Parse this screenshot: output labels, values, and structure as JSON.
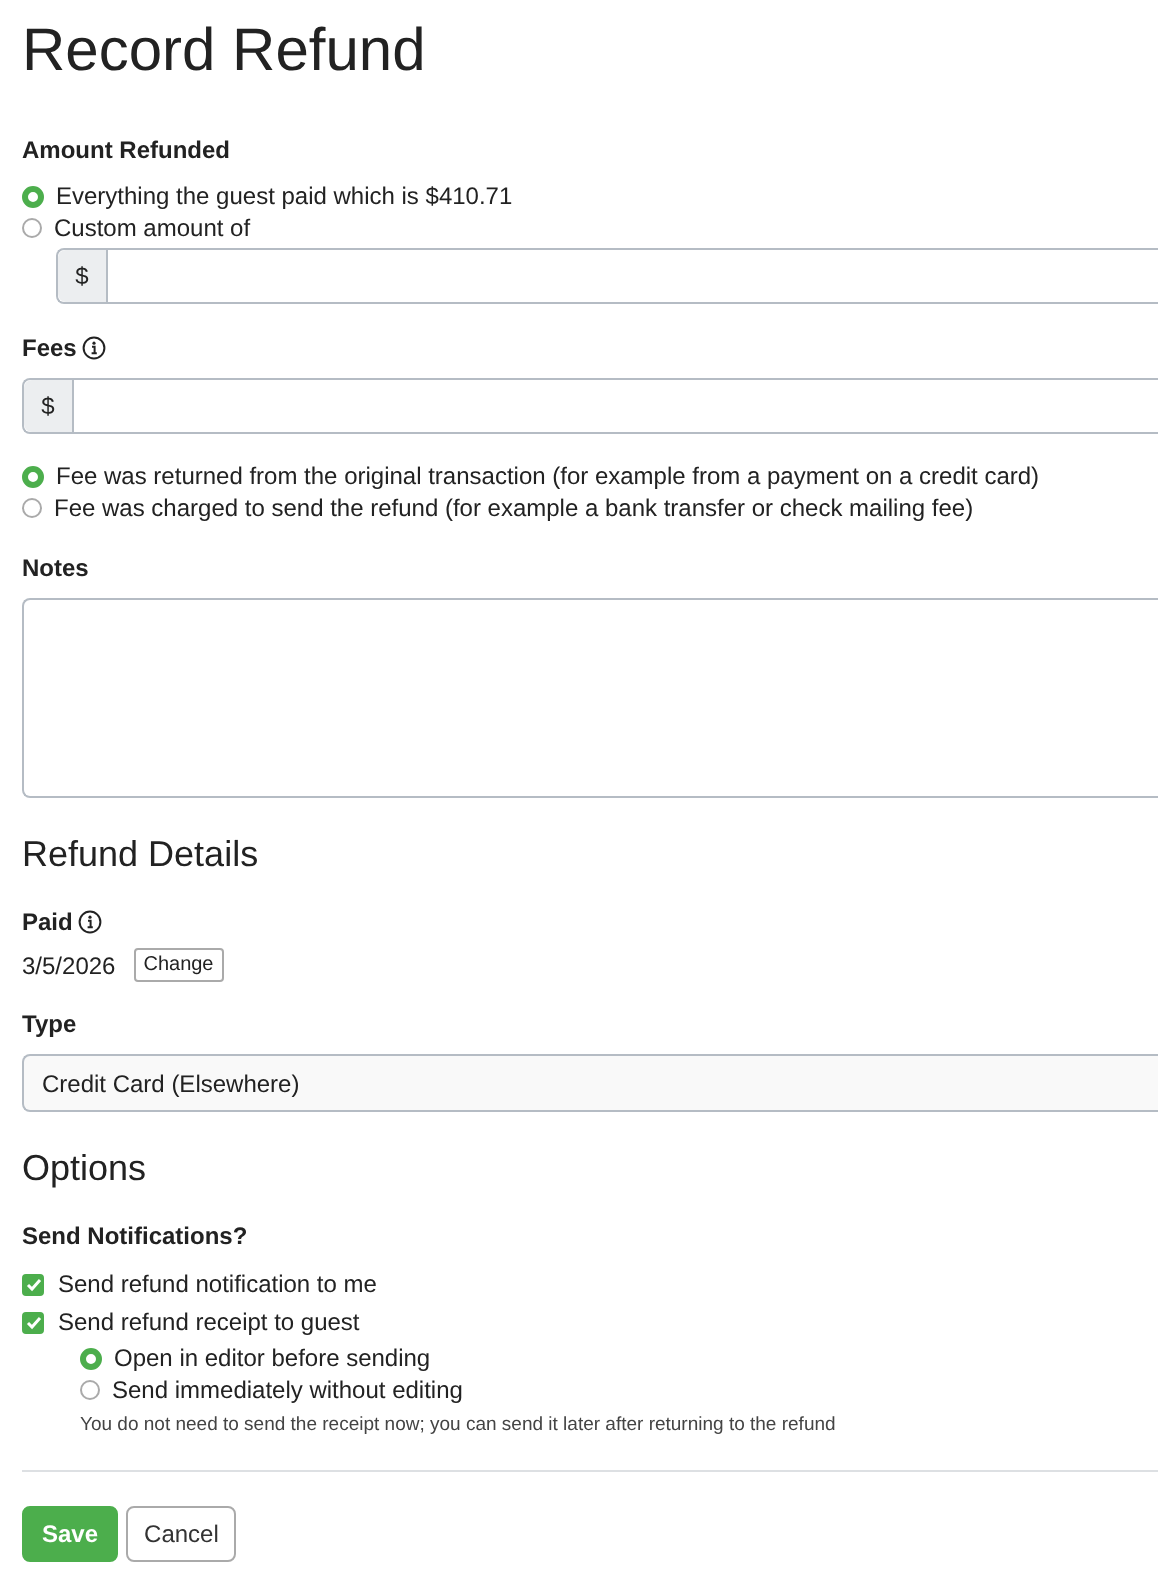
{
  "title": "Record Refund",
  "amount": {
    "label": "Amount Refunded",
    "options": [
      {
        "label": "Everything the guest paid which is $410.71",
        "selected": true
      },
      {
        "label": "Custom amount of",
        "selected": false
      }
    ],
    "field": {
      "prefix": "$"
    }
  },
  "fees": {
    "label": "Fees",
    "field": {
      "prefix": "$"
    },
    "options": [
      {
        "label": "Fee was returned from the original transaction (for example from a payment on a credit card)",
        "selected": true
      },
      {
        "label": "Fee was charged to send the refund (for example a bank transfer or check mailing fee)",
        "selected": false
      }
    ]
  },
  "notes": {
    "label": "Notes"
  },
  "refund_details": {
    "heading": "Refund Details",
    "paid": {
      "label": "Paid",
      "date": "3/5/2026",
      "button": "Change"
    },
    "type": {
      "label": "Type",
      "value": "Credit Card (Elsewhere)"
    }
  },
  "options": {
    "heading": "Options",
    "notifications": {
      "label": "Send Notifications?",
      "checks": [
        {
          "label": "Send refund notification to me",
          "checked": true
        },
        {
          "label": "Send refund receipt to guest",
          "checked": true
        }
      ],
      "receipt_options": [
        {
          "label": "Open in editor before sending",
          "selected": true
        },
        {
          "label": "Send immediately without editing",
          "selected": false
        }
      ],
      "hint": "You do not need to send the receipt now; you can send it later after returning to the refund"
    }
  },
  "buttons": [
    {
      "label": "Save",
      "kind": "primary"
    },
    {
      "label": "Cancel",
      "kind": "secondary"
    }
  ]
}
